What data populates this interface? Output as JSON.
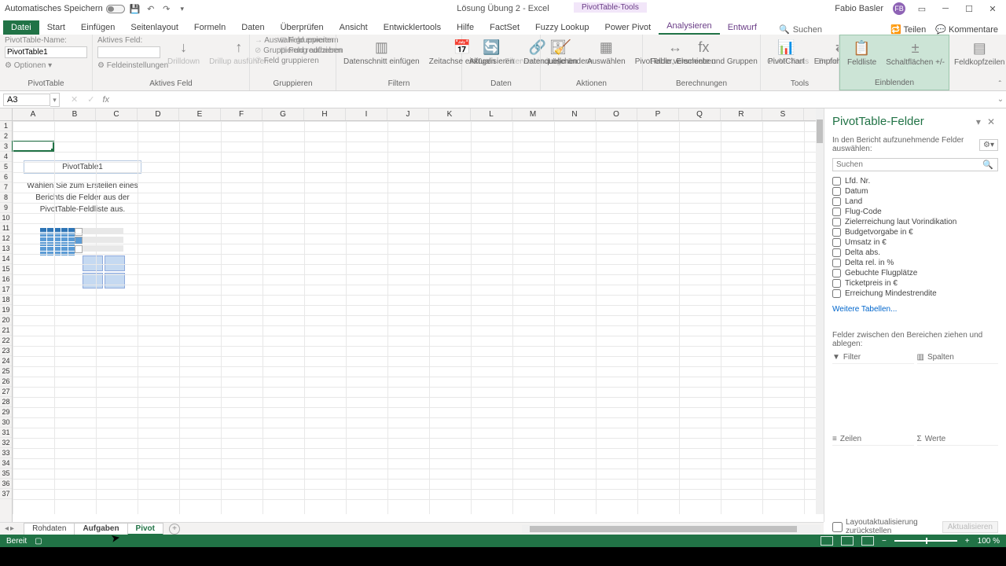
{
  "titlebar": {
    "autosave": "Automatisches Speichern",
    "doc_title": "Lösung Übung 2 - Excel",
    "tools_tab": "PivotTable-Tools",
    "user_name": "Fabio Basler",
    "user_initials": "FB"
  },
  "ribbon_tabs": {
    "file": "Datei",
    "items": [
      "Start",
      "Einfügen",
      "Seitenlayout",
      "Formeln",
      "Daten",
      "Überprüfen",
      "Ansicht",
      "Entwicklertools",
      "Hilfe",
      "FactSet",
      "Fuzzy Lookup",
      "Power Pivot"
    ],
    "context": [
      "Analysieren",
      "Entwurf"
    ],
    "search": "Suchen",
    "share": "Teilen",
    "comments": "Kommentare"
  },
  "ribbon": {
    "g1": {
      "label": "PivotTable",
      "name_label": "PivotTable-Name:",
      "name_value": "PivotTable1",
      "options": "Optionen"
    },
    "g2": {
      "label": "Aktives Feld",
      "field_label": "Aktives Feld:",
      "drilldown": "Drilldown",
      "drillup": "Drillup ausführen",
      "settings": "Feldeinstellungen",
      "expand": "Feld erweitern",
      "collapse": "Feld reduzieren"
    },
    "g3": {
      "label": "Gruppieren",
      "sel": "Auswahl gruppieren",
      "ungroup": "Gruppierung aufheben",
      "field": "Feld gruppieren"
    },
    "g4": {
      "label": "Filtern",
      "slicer": "Datenschnitt einfügen",
      "timeline": "Zeitachse einfügen",
      "conn": "Filterverbindungen"
    },
    "g5": {
      "label": "Daten",
      "refresh": "Aktualisieren",
      "source": "Datenquelle ändern"
    },
    "g6": {
      "label": "Aktionen",
      "clear": "Löschen",
      "select": "Auswählen",
      "move": "PivotTable verschieben"
    },
    "g7": {
      "label": "Berechnungen",
      "fields": "Felder, Elemente und Gruppen",
      "olap": "OLAP-Tools",
      "rel": "Beziehungen"
    },
    "g8": {
      "label": "Tools",
      "chart": "PivotChart",
      "rec": "Empfohlene PivotTables"
    },
    "g9": {
      "label": "Einblenden",
      "fieldlist": "Feldliste",
      "buttons": "Schaltflächen +/-",
      "headers": "Feldkopfzeilen"
    }
  },
  "namebox": "A3",
  "columns": [
    "A",
    "B",
    "C",
    "D",
    "E",
    "F",
    "G",
    "H",
    "I",
    "J",
    "K",
    "L",
    "M",
    "N",
    "O",
    "P",
    "Q",
    "R",
    "S"
  ],
  "rows": 37,
  "active_cell": {
    "col": 0,
    "row": 2
  },
  "pivot_placeholder": {
    "name": "PivotTable1",
    "help1": "Wählen Sie zum Erstellen eines",
    "help2": "Berichts die Felder aus der",
    "help3": "PivotTable-Feldliste aus."
  },
  "sheets": {
    "items": [
      "Rohdaten",
      "Aufgaben",
      "Pivot"
    ],
    "active": "Pivot"
  },
  "statusbar": {
    "ready": "Bereit",
    "zoom": "100 %"
  },
  "taskpane": {
    "title": "PivotTable-Felder",
    "subtitle": "In den Bericht aufzunehmende Felder auswählen:",
    "search_placeholder": "Suchen",
    "fields": [
      "Lfd. Nr.",
      "Datum",
      "Land",
      "Flug-Code",
      "Zielerreichung laut Vorindikation",
      "Budgetvorgabe in €",
      "Umsatz in €",
      "Delta abs.",
      "Delta rel. in %",
      "Gebuchte Flugplätze",
      "Ticketpreis in €",
      "Erreichung Mindestrendite"
    ],
    "more_tables": "Weitere Tabellen...",
    "drag_text": "Felder zwischen den Bereichen ziehen und ablegen:",
    "areas": {
      "filter": "Filter",
      "columns": "Spalten",
      "rows": "Zeilen",
      "values": "Werte"
    },
    "defer": "Layoutaktualisierung zurückstellen",
    "update": "Aktualisieren"
  }
}
